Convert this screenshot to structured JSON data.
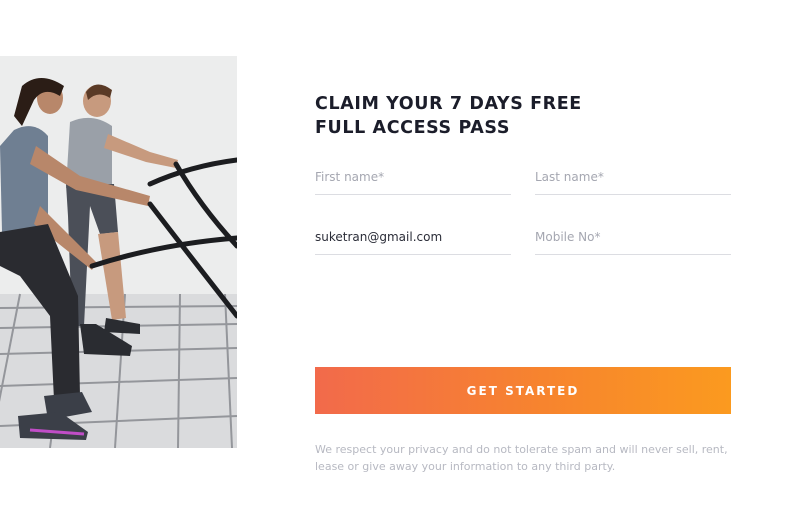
{
  "hero": {
    "title_line1": "CLAIM YOUR 7 DAYS FREE",
    "title_line2": "FULL ACCESS PASS"
  },
  "form": {
    "first_name": {
      "value": "",
      "placeholder": "First name*"
    },
    "last_name": {
      "value": "",
      "placeholder": "Last name*"
    },
    "email": {
      "value": "suketran@gmail.com",
      "placeholder": ""
    },
    "mobile": {
      "value": "",
      "placeholder": "Mobile No*"
    },
    "submit_label": "GET STARTED"
  },
  "privacy_note": "We respect your privacy and do not tolerate spam and will never sell, rent, lease or give away your information to any third party.",
  "colors": {
    "title": "#1b1d2a",
    "button_gradient_start": "#f26a4b",
    "button_gradient_end": "#fb9a1f",
    "input_underline": "#dcdde2",
    "placeholder": "#a5a7b1",
    "note": "#b7b9c2"
  }
}
